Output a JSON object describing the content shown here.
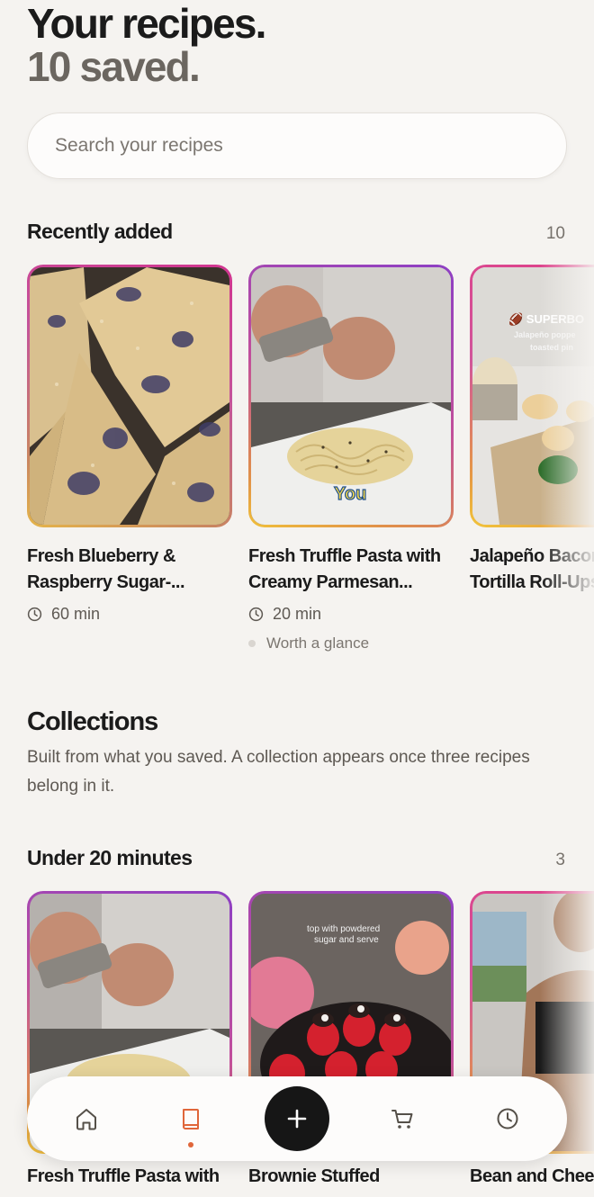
{
  "header": {
    "title": "Your recipes.",
    "subtitle": "10 saved."
  },
  "search": {
    "placeholder": "Search your recipes"
  },
  "recently_added": {
    "title": "Recently added",
    "count": "10",
    "cards": [
      {
        "title": "Fresh Blueberry & Raspberry Sugar-...",
        "title_line1": "Fresh Blueberry &",
        "title_line2": "Raspberry Sugar-...",
        "time": "60 min"
      },
      {
        "title": "Fresh Truffle Pasta with Creamy Parmesan...",
        "title_line1": "Fresh Truffle Pasta with",
        "title_line2": "Creamy Parmesan...",
        "time": "20 min",
        "tag": "Worth a glance",
        "overlay": "You"
      },
      {
        "title": "Jalapeño Bacon Tortilla Roll-Ups",
        "title_line1": "Jalapeño Bacon",
        "title_line2": "Tortilla Roll-Ups",
        "overlay_line1": "🏈 SUPERBO",
        "overlay_line2": "Jalapeño poppe",
        "overlay_line3": "toasted pin"
      }
    ]
  },
  "collections": {
    "title": "Collections",
    "description": "Built from what you saved. A collection appears once three recipes belong in it."
  },
  "under_20": {
    "title": "Under 20 minutes",
    "count": "3",
    "cards": [
      {
        "title": "Fresh Truffle Pasta with"
      },
      {
        "title": "Brownie Stuffed",
        "overlay_line1": "top with powdered",
        "overlay_line2": "sugar and serve"
      },
      {
        "title": "Bean and Chee"
      }
    ]
  },
  "nav": {
    "items": [
      "home-icon",
      "book-icon",
      "plus-icon",
      "cart-icon",
      "clock-icon"
    ],
    "active": "book-icon",
    "accent": "#e0663a"
  }
}
